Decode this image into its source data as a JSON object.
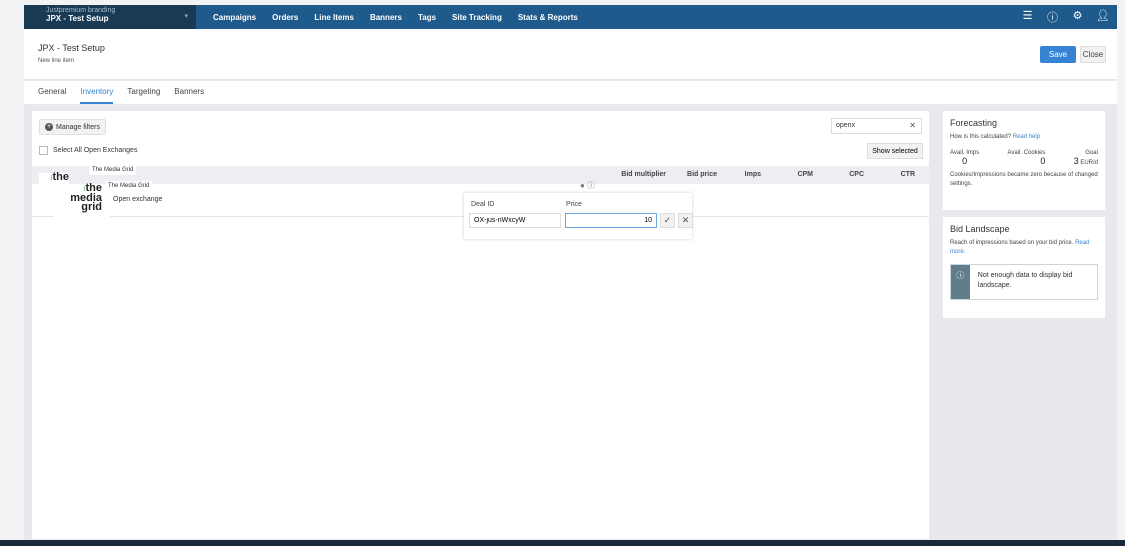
{
  "nav": {
    "brand_sub": "Justpremium branding",
    "brand_title": "JPX - Test Setup",
    "items": [
      "Campaigns",
      "Orders",
      "Line Items",
      "Banners",
      "Tags",
      "Site Tracking",
      "Stats & Reports"
    ],
    "icons": [
      "document-icon",
      "help-icon",
      "settings-icon",
      "user-icon"
    ]
  },
  "header": {
    "title": "JPX - Test Setup",
    "subtitle": "New line item",
    "save": "Save",
    "close": "Close"
  },
  "tabs": [
    {
      "label": "General"
    },
    {
      "label": "Inventory",
      "active": true
    },
    {
      "label": "Targeting"
    },
    {
      "label": "Banners"
    }
  ],
  "inventory": {
    "manage_filters": "Manage filters",
    "select_all": "Select All Open Exchanges",
    "search_value": "openx",
    "show_selected": "Show selected",
    "columns": [
      "Bid multiplier",
      "Bid price",
      "Imps",
      "CPM",
      "CPC",
      "CTR"
    ],
    "logo_text": [
      "the",
      "media",
      "grid"
    ],
    "partner_name": "The Media Grid",
    "row_type": "Open exchange",
    "popup": {
      "deal_id_label": "Deal ID",
      "deal_id_value": "OX-jus-nWxcyW",
      "price_label": "Price",
      "price_value": "10"
    }
  },
  "forecasting": {
    "title": "Forecasting",
    "how": "How is this calculated?",
    "read_help": "Read help",
    "imps_label": "Avail. Imps",
    "imps": "0",
    "cookies_label": "Avail. Cookies",
    "cookies": "0",
    "goal_label": "Goal",
    "goal": "3",
    "goal_unit": "EUR/d",
    "note": "Cookies/Impressions became zero because of changed settings."
  },
  "bid_landscape": {
    "title": "Bid Landscape",
    "desc": "Reach of impressions based on your bid price.",
    "read_more": "Read more.",
    "alert": "Not enough data to display bid landscape."
  },
  "colors": {
    "nav": "#1f5a8c",
    "brand": "#183a55",
    "accent": "#3683d3"
  }
}
